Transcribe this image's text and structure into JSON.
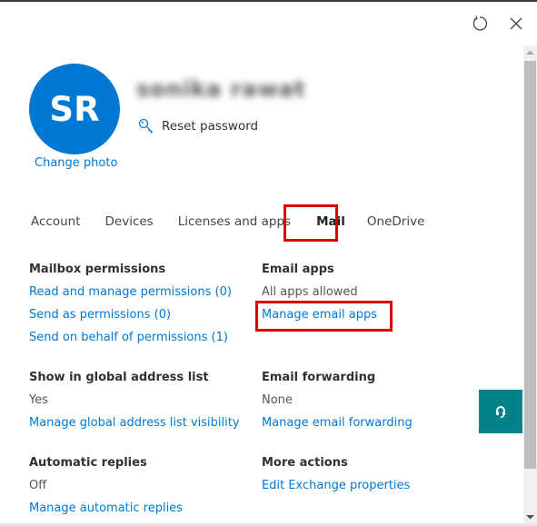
{
  "header": {
    "refresh_icon": "refresh-icon",
    "close_icon": "close-icon"
  },
  "profile": {
    "initials": "SR",
    "name": "sonika rawat",
    "change_photo": "Change photo",
    "reset_password": "Reset password",
    "reset_icon": "key-icon",
    "avatar_color": "#0078d4"
  },
  "tabs": [
    {
      "label": "Account",
      "active": false
    },
    {
      "label": "Devices",
      "active": false
    },
    {
      "label": "Licenses and apps",
      "active": false
    },
    {
      "label": "Mail",
      "active": true
    },
    {
      "label": "OneDrive",
      "active": false
    }
  ],
  "sections": {
    "mailbox_permissions": {
      "title": "Mailbox permissions",
      "links": [
        "Read and manage permissions (0)",
        "Send as permissions (0)",
        "Send on behalf of permissions (1)"
      ]
    },
    "email_apps": {
      "title": "Email apps",
      "value": "All apps allowed",
      "link": "Manage email apps"
    },
    "global_address_list": {
      "title": "Show in global address list",
      "value": "Yes",
      "link": "Manage global address list visibility"
    },
    "email_forwarding": {
      "title": "Email forwarding",
      "value": "None",
      "link": "Manage email forwarding"
    },
    "automatic_replies": {
      "title": "Automatic replies",
      "value": "Off",
      "link": "Manage automatic replies"
    },
    "more_actions": {
      "title": "More actions",
      "link": "Edit Exchange properties"
    }
  },
  "help_button": {
    "icon": "headset-icon",
    "color": "#038387"
  },
  "colors": {
    "link": "#0078d4",
    "highlight_box": "#e00000"
  }
}
